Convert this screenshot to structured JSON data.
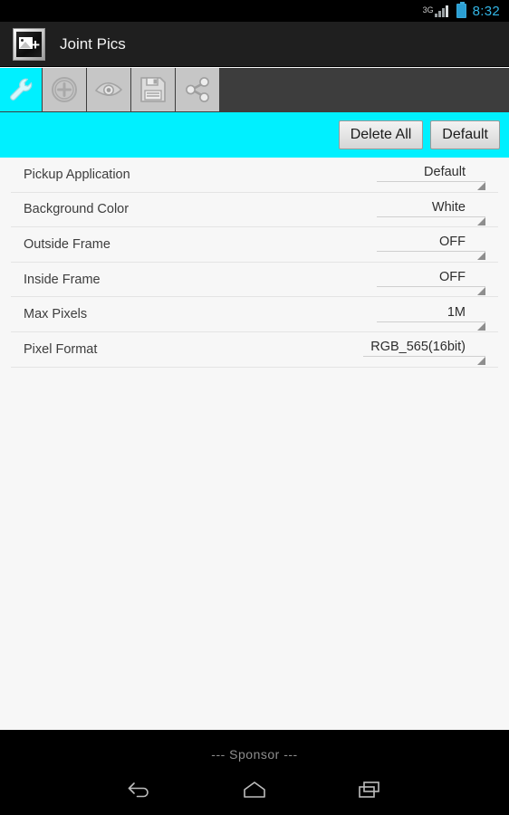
{
  "status_bar": {
    "network_label": "3G",
    "signal_icon": "signal-bars-icon",
    "battery_icon": "battery-charging-icon",
    "time": "8:32",
    "time_color": "#33b5e5"
  },
  "action_bar": {
    "app_icon": "joint-pics-app-icon",
    "title": "Joint Pics"
  },
  "tabs": [
    {
      "id": "settings",
      "icon": "wrench-icon",
      "selected": true
    },
    {
      "id": "add",
      "icon": "plus-circle-icon",
      "selected": false
    },
    {
      "id": "preview",
      "icon": "eye-icon",
      "selected": false
    },
    {
      "id": "save",
      "icon": "floppy-disk-icon",
      "selected": false
    },
    {
      "id": "share",
      "icon": "share-icon",
      "selected": false
    }
  ],
  "toolbar": {
    "background_color": "#00f0ff",
    "delete_all_label": "Delete All",
    "default_label": "Default"
  },
  "settings": {
    "rows": [
      {
        "label": "Pickup Application",
        "value": "Default"
      },
      {
        "label": "Background Color",
        "value": "White"
      },
      {
        "label": "Outside Frame",
        "value": "OFF"
      },
      {
        "label": "Inside Frame",
        "value": "OFF"
      },
      {
        "label": "Max Pixels",
        "value": "1M"
      },
      {
        "label": "Pixel Format",
        "value": "RGB_565(16bit)"
      }
    ]
  },
  "footer": {
    "sponsor_text": "--- Sponsor ---"
  },
  "nav_bar": {
    "back_icon": "back-arrow-icon",
    "home_icon": "home-icon",
    "recents_icon": "recent-apps-icon"
  }
}
